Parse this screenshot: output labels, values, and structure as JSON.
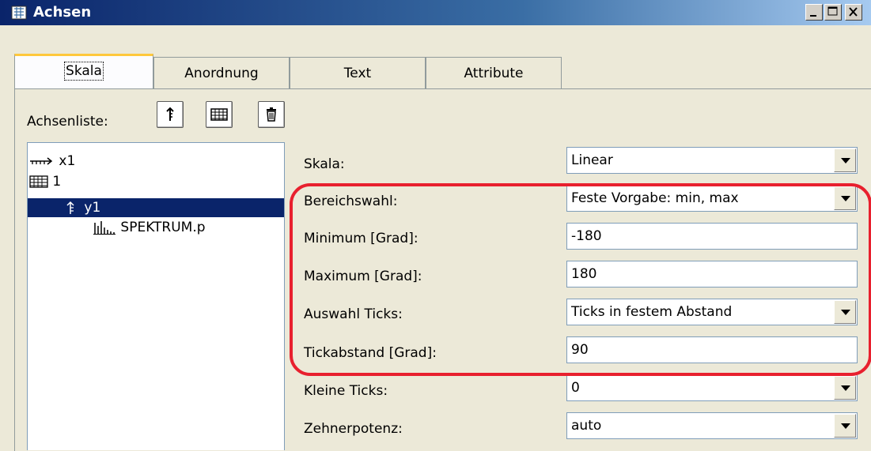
{
  "window": {
    "title": "Achsen",
    "title_icon": "axes-window-icon"
  },
  "tabs": [
    {
      "label": "Skala",
      "active": true
    },
    {
      "label": "Anordnung",
      "active": false
    },
    {
      "label": "Text",
      "active": false
    },
    {
      "label": "Attribute",
      "active": false
    }
  ],
  "axis_list": {
    "label": "Achsenliste:",
    "toolbar_icons": [
      "new-y-axis-icon",
      "new-grid-axis-icon",
      "delete-trash-icon"
    ],
    "items": [
      {
        "label": "x1",
        "icon": "x-axis-icon"
      },
      {
        "label": "1",
        "icon": "grid-axis-icon"
      },
      {
        "label": "y1",
        "icon": "y-axis-icon",
        "selected": true
      },
      {
        "label": "SPEKTRUM.p",
        "icon": "spectrum-chart-icon"
      }
    ]
  },
  "fields": {
    "scale": {
      "label": "Skala:",
      "value": "Linear"
    },
    "range_mode": {
      "label": "Bereichswahl:",
      "value": "Feste Vorgabe: min, max"
    },
    "minimum": {
      "label": "Minimum [Grad]:",
      "value": "-180"
    },
    "maximum": {
      "label": "Maximum [Grad]:",
      "value": "180"
    },
    "tick_mode": {
      "label": "Auswahl Ticks:",
      "value": "Ticks in festem Abstand"
    },
    "tick_spacing": {
      "label": "Tickabstand [Grad]:",
      "value": "90"
    },
    "minor_ticks": {
      "label": "Kleine Ticks:",
      "value": "0"
    },
    "power_of_ten": {
      "label": "Zehnerpotenz:",
      "value": "auto"
    }
  },
  "highlight_color": "#e8202e"
}
